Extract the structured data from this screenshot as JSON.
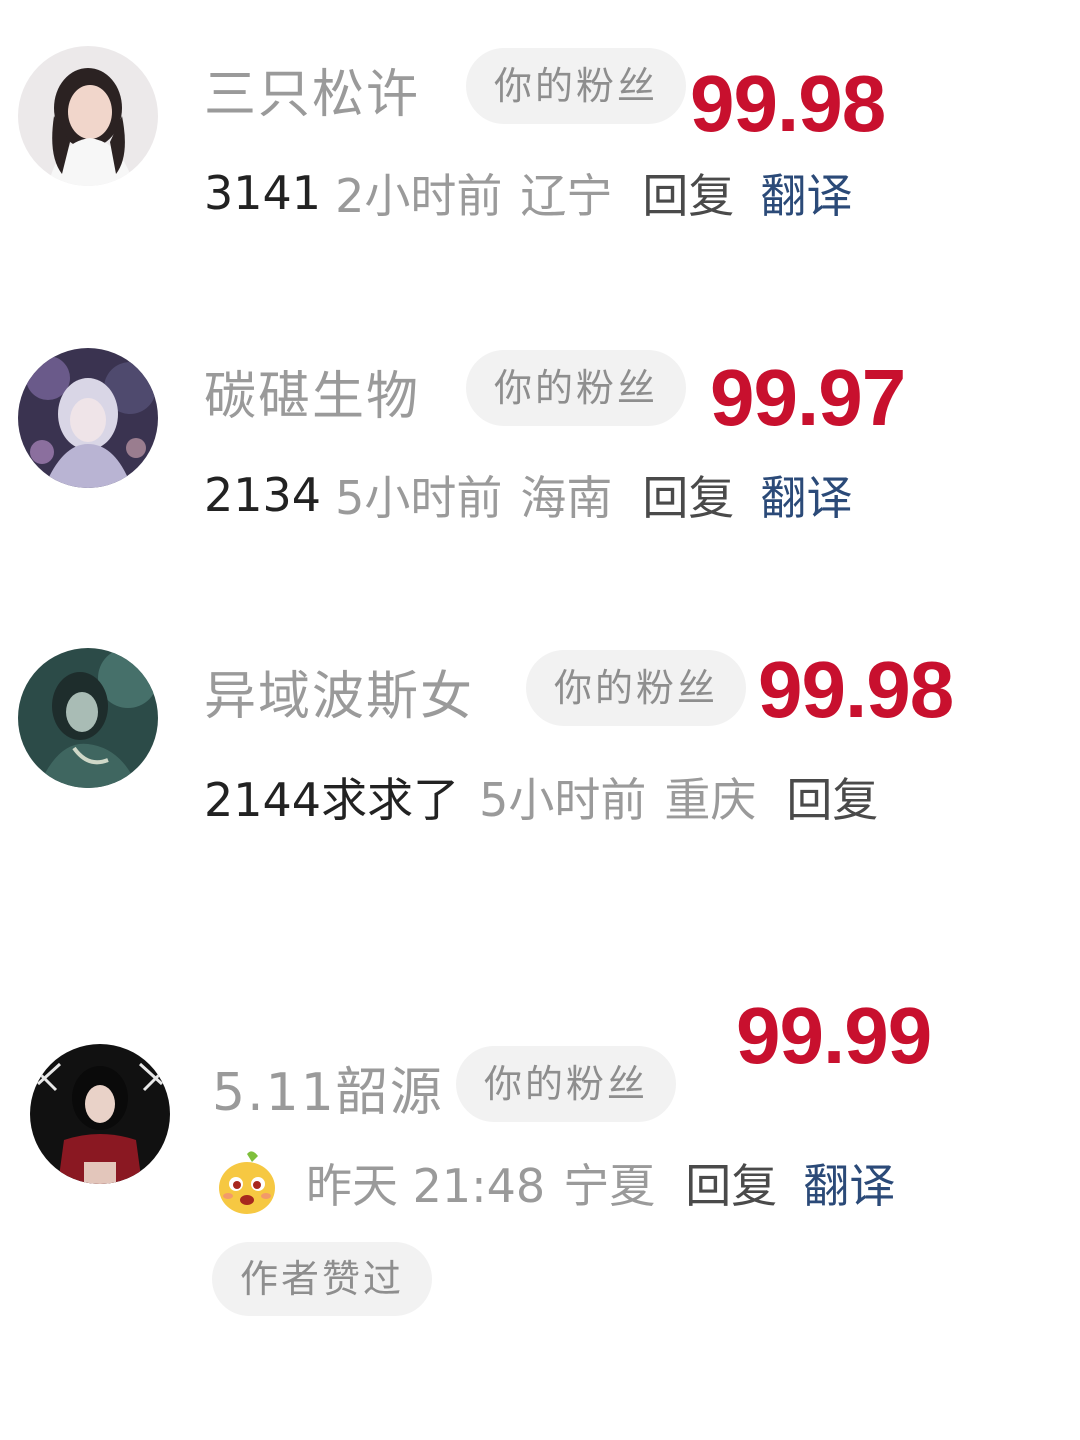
{
  "comments": [
    {
      "username": "三只松许",
      "fan_badge": "你的粉丝",
      "score": "99.98",
      "text": "3141",
      "time": "2小时前",
      "location": "辽宁",
      "reply": "回复",
      "translate": "翻译"
    },
    {
      "username": "碳碪生物",
      "fan_badge": "你的粉丝",
      "score": "99.97",
      "text": "2134",
      "time": "5小时前",
      "location": "海南",
      "reply": "回复",
      "translate": "翻译"
    },
    {
      "username": "异域波斯女",
      "fan_badge": "你的粉丝",
      "score": "99.98",
      "text": "2144求求了",
      "time": "5小时前",
      "location": "重庆",
      "reply": "回复"
    },
    {
      "username": "5.11韶源",
      "fan_badge": "你的粉丝",
      "score": "99.99",
      "emoji": "cartoon-face-emoji",
      "time": "昨天 21:48",
      "location": "宁夏",
      "reply": "回复",
      "translate": "翻译",
      "liked_badge": "作者赞过"
    }
  ],
  "colors": {
    "score": "#c8102e",
    "username": "#9a9a9a",
    "badge_bg": "#f2f2f2",
    "translate": "#2b4a78"
  }
}
